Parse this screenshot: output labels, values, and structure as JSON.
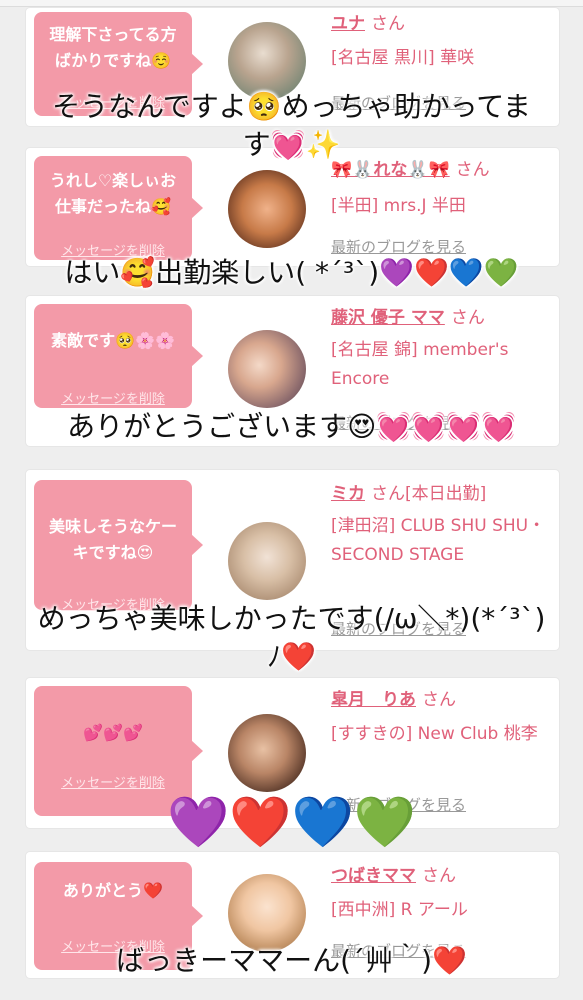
{
  "delete_label": "メッセージを削除",
  "blog_label": "最新のブログを見る",
  "honorific": "さん",
  "cards": [
    {
      "message_line1": "理解下さってる方",
      "message_line2": "ばかりですね☺️",
      "name": "ユナ",
      "shop": "[名古屋 黒川] 華咲",
      "overlay": "そうなんですよ🥺めっちゃ助かってま",
      "overlay2": "す💓✨"
    },
    {
      "message_line1": "うれし♡楽しぃお",
      "message_line2": "仕事だったね🥰",
      "name": "🎀🐰れな🐰🎀",
      "shop": "[半田] mrs.J 半田",
      "overlay": "はい🥰出勤楽しい( *´³`)💜❤️💙💚"
    },
    {
      "message_line1": "素敵です🥺🌸🌸",
      "message_line2": "",
      "name": "藤沢 優子 ママ",
      "shop": "[名古屋 錦] member's Encore",
      "overlay": "ありがとうございます😍💓💓💓💓"
    },
    {
      "message_line1": "美味しそうなケー",
      "message_line2": "キですね😍",
      "name": "ミカ",
      "name_suffix": "[本日出勤]",
      "shop": "[津田沼] CLUB SHU SHU・SECOND STAGE",
      "overlay": "めっちゃ美味しかったです(/ω＼*)(*´³`)",
      "overlay2": "ﾉ❤️"
    },
    {
      "message_line1": "💕💕💕",
      "message_line2": "",
      "name": "皐月　りあ",
      "shop": "[すすきの] New Club 桃李",
      "overlay": "💜❤️💙💚"
    },
    {
      "message_line1": "ありがとう❤️",
      "message_line2": "",
      "name": "つばきママ",
      "shop": "[西中洲] R アール",
      "overlay": "ばっきーママーん(´艸｀)❤️"
    }
  ],
  "colors": {
    "bubble": "#f39aa8",
    "link": "#e0617a",
    "muted": "#999999"
  }
}
